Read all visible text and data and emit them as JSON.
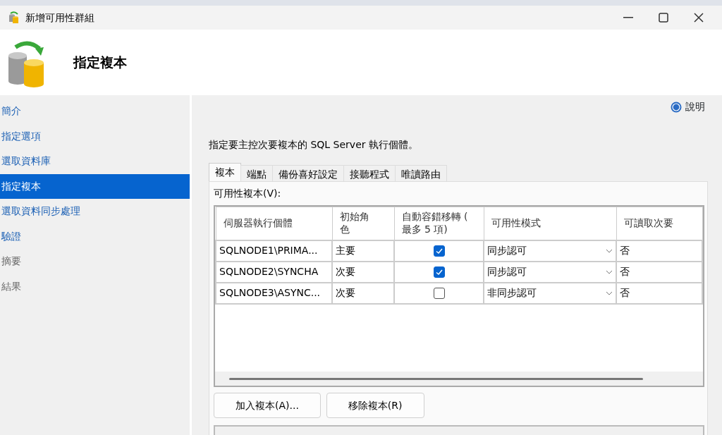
{
  "window": {
    "title": "新增可用性群組"
  },
  "header": {
    "title": "指定複本"
  },
  "sidebar": {
    "items": [
      {
        "label": "簡介",
        "selected": false,
        "enabled": true
      },
      {
        "label": "指定選項",
        "selected": false,
        "enabled": true
      },
      {
        "label": "選取資料庫",
        "selected": false,
        "enabled": true
      },
      {
        "label": "指定複本",
        "selected": true,
        "enabled": true
      },
      {
        "label": "選取資料同步處理",
        "selected": false,
        "enabled": true
      },
      {
        "label": "驗證",
        "selected": false,
        "enabled": true
      },
      {
        "label": "摘要",
        "selected": false,
        "enabled": false
      },
      {
        "label": "結果",
        "selected": false,
        "enabled": false
      }
    ]
  },
  "help": {
    "label": "說明"
  },
  "instruction": "指定要主控次要複本的 SQL Server 執行個體。",
  "tabs": [
    {
      "label": "複本",
      "selected": true
    },
    {
      "label": "端點",
      "selected": false
    },
    {
      "label": "備份喜好設定",
      "selected": false
    },
    {
      "label": "接聽程式",
      "selected": false
    },
    {
      "label": "唯讀路由",
      "selected": false
    }
  ],
  "grid": {
    "label": "可用性複本(V):",
    "columns": [
      "伺服器執行個體",
      "初始角色",
      "自動容錯移轉 ( 最多 5 項)",
      "可用性模式",
      "可讀取次要"
    ],
    "rows": [
      {
        "server": "SQLNODE1\\PRIMA...",
        "role": "主要",
        "auto_failover": true,
        "mode": "同步認可",
        "readable": "否"
      },
      {
        "server": "SQLNODE2\\SYNCHA",
        "role": "次要",
        "auto_failover": true,
        "mode": "同步認可",
        "readable": "否"
      },
      {
        "server": "SQLNODE3\\ASYNC...",
        "role": "次要",
        "auto_failover": false,
        "mode": "非同步認可",
        "readable": "否"
      }
    ]
  },
  "buttons": [
    "加入複本(A)...",
    "移除複本(R)"
  ]
}
